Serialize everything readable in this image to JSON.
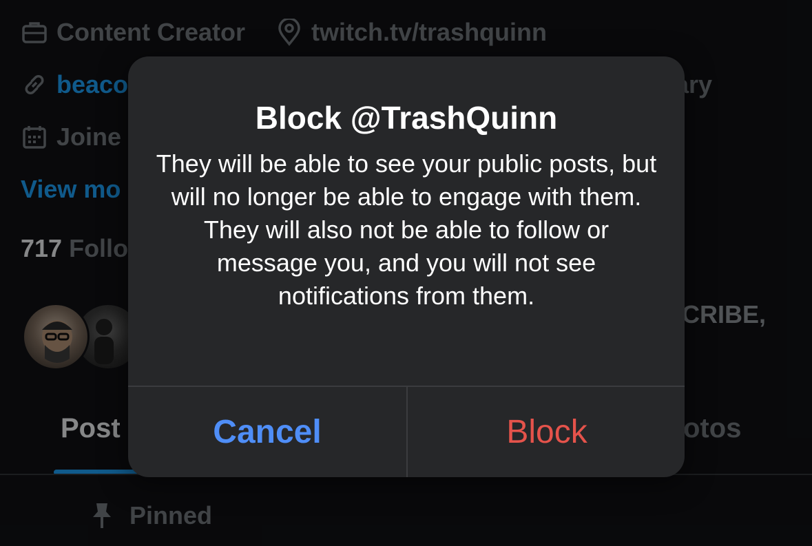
{
  "profile": {
    "job": "Content Creator",
    "location": "twitch.tv/trashquinn",
    "website_partial": "beaco",
    "website_suffix_partial": "ary",
    "joined_partial": "Joine",
    "view_more_partial": "View mo",
    "followers_count": "717",
    "followers_label_partial": "Follo",
    "bio_partial": "CRIBE,"
  },
  "tabs": {
    "posts_partial": "Post",
    "photos_partial": "otos"
  },
  "pinned": {
    "label": "Pinned"
  },
  "alert": {
    "title": "Block @TrashQuinn",
    "message": "They will be able to see your public posts, but will no longer be able to engage with them. They will also not be able to follow or message you, and you will not see notifications from them.",
    "cancel_label": "Cancel",
    "block_label": "Block"
  },
  "colors": {
    "accent": "#1d9bf0",
    "cancel": "#4f8ef7",
    "destructive": "#e5534b"
  }
}
